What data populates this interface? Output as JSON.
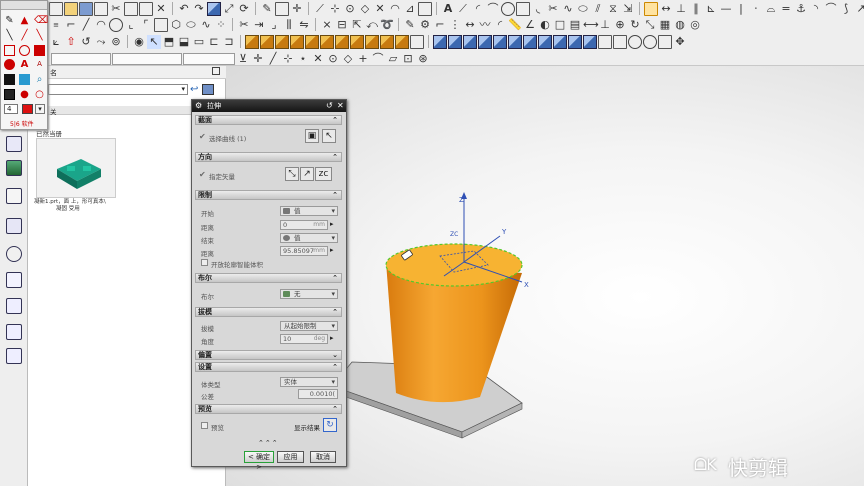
{
  "toolbar": {
    "combo_filter": "",
    "combo_selection": "",
    "combo_snap": ""
  },
  "palette": {
    "swatch_value": "4",
    "footer_text": "5|6 软件"
  },
  "resource_panel": {
    "header_label": "名",
    "subheader_label": "关",
    "part_name_1": "已然当册",
    "part_thumb_caption": "凝新1.prt，面 上，形可真本\\\n　　　　凝固 受用"
  },
  "dialog": {
    "title": "拉伸",
    "sections": {
      "section_curve": "截面",
      "direction": "方向",
      "limits": "限制",
      "boolean": "布尔",
      "draft": "拔模",
      "offset": "偏置",
      "settings": "设置",
      "preview": "预览"
    },
    "curve_select_label": "选择曲线 (1)",
    "direction_label": "指定矢量",
    "limits": {
      "start_label": "开始",
      "start_value": "值",
      "start_distance_label": "距离",
      "start_distance_value": "0",
      "start_unit": "mm",
      "end_label": "结束",
      "end_value": "值",
      "end_distance_label": "距离",
      "end_distance_value": "95.85097",
      "end_unit": "mm",
      "open_profile_label": "开放轮廓智能体积"
    },
    "boolean": {
      "boolean_label": "布尔",
      "boolean_value": "无"
    },
    "draft": {
      "draft_label": "拔模",
      "draft_value": "从起始限制",
      "angle_label": "角度",
      "angle_value": "10",
      "angle_unit": "deg"
    },
    "settings": {
      "body_type_label": "体类型",
      "body_type_value": "实体",
      "tolerance_label": "公差",
      "tolerance_value": "0.0010("
    },
    "preview": {
      "preview_label": "预览",
      "show_result_label": "显示结果"
    },
    "ok_label": "< 确定 >",
    "apply_label": "应用",
    "cancel_label": "取消"
  },
  "viewport": {
    "axis_x": "X",
    "axis_y": "Y",
    "axis_z": "Z",
    "axis_zc": "ZC",
    "colors": {
      "body_light": "#f2a12d",
      "body_dark": "#c86e08",
      "top_face": "#f7b332",
      "base_plate": "#c9c9c9",
      "highlight_edge": "#56c82a"
    }
  },
  "watermark": {
    "text": "快剪辑"
  }
}
